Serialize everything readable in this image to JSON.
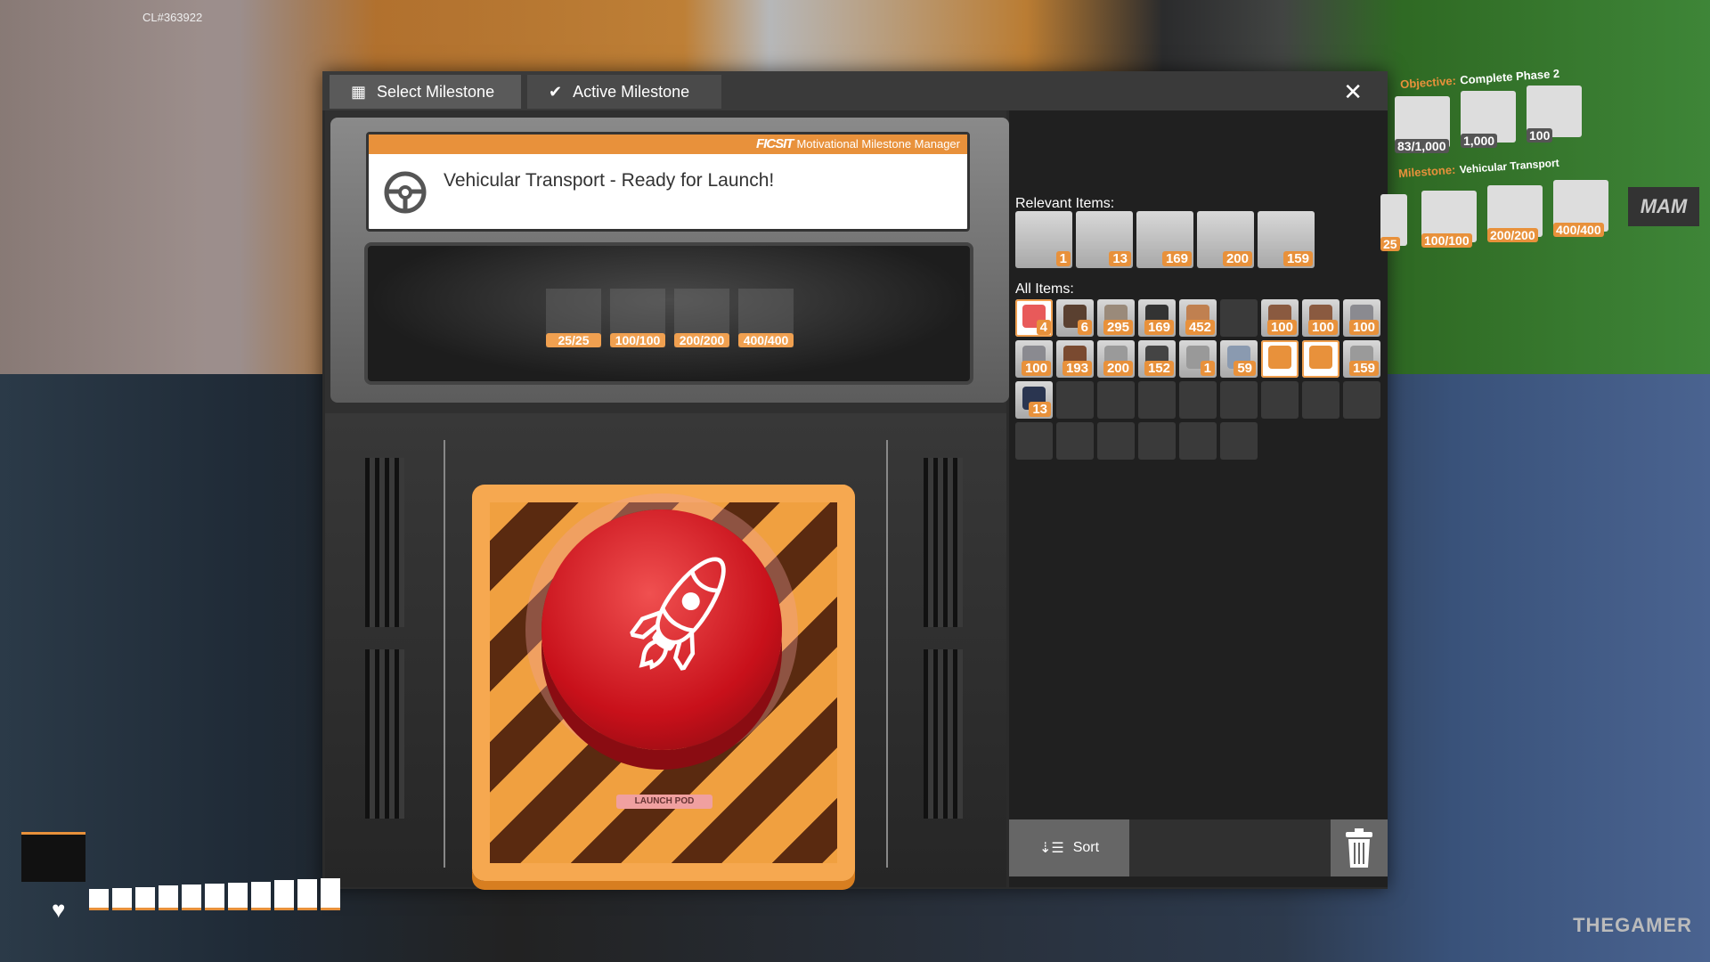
{
  "build_label": "CL#363922",
  "tabs": [
    {
      "label": "Select Milestone",
      "icon": "grid-icon"
    },
    {
      "label": "Active Milestone",
      "icon": "check-icon"
    }
  ],
  "close_icon": "close-icon",
  "header": {
    "brand": "FICSIT",
    "subtitle": "Motivational Milestone Manager",
    "title": "Vehicular Transport - Ready for Launch!",
    "icon": "steering-wheel-icon"
  },
  "costs": [
    "25/25",
    "100/100",
    "200/200",
    "400/400"
  ],
  "launch_label": "LAUNCH POD",
  "relevant_label": "Relevant Items:",
  "relevant_items": [
    "1",
    "13",
    "169",
    "200",
    "159"
  ],
  "all_label": "All Items:",
  "all_items": [
    {
      "c": "4",
      "hl": true,
      "col": "#e85a5a"
    },
    {
      "c": "6",
      "col": "#5a4030"
    },
    {
      "c": "295",
      "col": "#9a8a7a"
    },
    {
      "c": "169",
      "col": "#333"
    },
    {
      "c": "452",
      "col": "#c08050"
    },
    {
      "c": ""
    },
    {
      "c": "100",
      "col": "#8a5a40"
    },
    {
      "c": "100",
      "col": "#8a5a40"
    },
    {
      "c": "100",
      "col": "#8a8a90"
    },
    {
      "c": "100",
      "col": "#8a8a90"
    },
    {
      "c": "193",
      "col": "#7a4a30"
    },
    {
      "c": "200",
      "col": "#9a9a9a"
    },
    {
      "c": "152",
      "col": "#444"
    },
    {
      "c": "1",
      "col": "#999"
    },
    {
      "c": "59",
      "col": "#8a9ab0"
    },
    {
      "c": "",
      "hl": true,
      "col": "#e8913b",
      "filled": true
    },
    {
      "c": "",
      "hl": true,
      "col": "#e8913b",
      "filled": true
    },
    {
      "c": "159",
      "col": "#9a9a9a"
    },
    {
      "c": "13",
      "col": "#2a3550"
    },
    {
      "c": ""
    },
    {
      "c": ""
    },
    {
      "c": ""
    },
    {
      "c": ""
    },
    {
      "c": ""
    },
    {
      "c": ""
    },
    {
      "c": ""
    },
    {
      "c": ""
    },
    {
      "c": ""
    },
    {
      "c": ""
    },
    {
      "c": ""
    },
    {
      "c": ""
    },
    {
      "c": ""
    },
    {
      "c": ""
    }
  ],
  "sort_label": "Sort",
  "trash_icon": "trash-icon",
  "hud": {
    "objective_label": "Objective:",
    "objective": "Complete Phase 2",
    "objective_items": [
      "83/1,000",
      "1,000",
      "100"
    ],
    "milestone_label": "Milestone:",
    "milestone": "Vehicular Transport",
    "milestone_items": [
      "25",
      "100/100",
      "200/200",
      "400/400"
    ],
    "mam": "MAM"
  },
  "health_segments": 11,
  "watermark": "THEGAMER"
}
